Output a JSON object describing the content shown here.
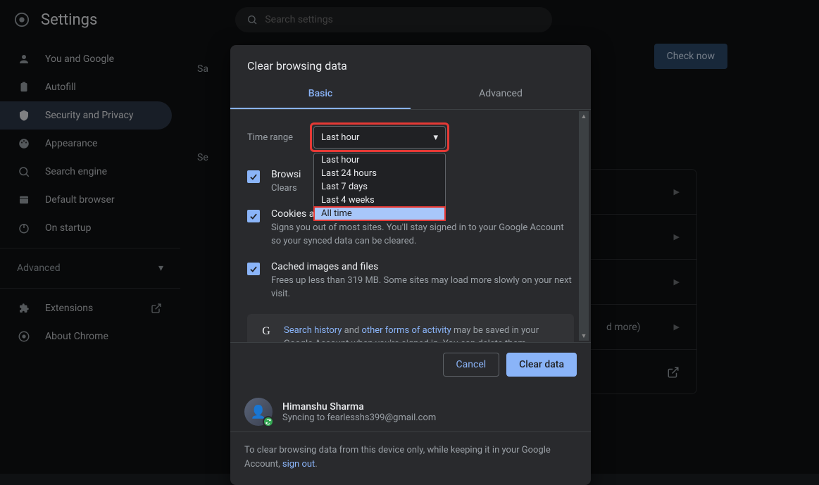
{
  "header": {
    "title": "Settings",
    "search_placeholder": "Search settings"
  },
  "sidebar": {
    "items": [
      {
        "label": "You and Google"
      },
      {
        "label": "Autofill"
      },
      {
        "label": "Security and Privacy"
      },
      {
        "label": "Appearance"
      },
      {
        "label": "Search engine"
      },
      {
        "label": "Default browser"
      },
      {
        "label": "On startup"
      }
    ],
    "advanced_label": "Advanced",
    "extensions_label": "Extensions",
    "about_label": "About Chrome"
  },
  "background": {
    "sa_label": "Sa",
    "se_label": "Se",
    "check_now": "Check now",
    "more_label": "d more)"
  },
  "dialog": {
    "title": "Clear browsing data",
    "tabs": {
      "basic": "Basic",
      "advanced": "Advanced"
    },
    "time_range_label": "Time range",
    "dropdown_selected": "Last hour",
    "dropdown_options": [
      "Last hour",
      "Last 24 hours",
      "Last 7 days",
      "Last 4 weeks",
      "All time"
    ],
    "items": [
      {
        "title": "Browsi",
        "desc": "Clears"
      },
      {
        "title": "Cookies and other site data",
        "desc": "Signs you out of most sites. You'll stay signed in to your Google Account so your synced data can be cleared."
      },
      {
        "title": "Cached images and files",
        "desc": "Frees up less than 319 MB. Some sites may load more slowly on your next visit."
      }
    ],
    "info": {
      "search_history": "Search history",
      "and": " and ",
      "other_forms": "other forms of activity",
      "rest": " may be saved in your Google Account when you're signed in. You can delete them anytime."
    },
    "buttons": {
      "cancel": "Cancel",
      "clear": "Clear data"
    },
    "account": {
      "name": "Himanshu Sharma",
      "sync_prefix": "Syncing to ",
      "email": "fearlesshs399@gmail.com"
    },
    "note": {
      "text1": "To clear browsing data from this device only, while keeping it in your Google Account, ",
      "signout": "sign out",
      "text2": "."
    }
  }
}
